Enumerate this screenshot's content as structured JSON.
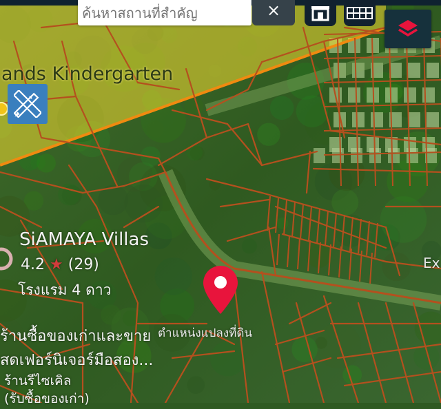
{
  "search": {
    "placeholder": "ค้นหาสถานที่สำคัญ",
    "clear_label": "×"
  },
  "icons": {
    "clear": "close-icon",
    "building": "building-icon",
    "grid": "grid-icon",
    "layers": "layers-icon",
    "measure": "ruler-pencil-icon",
    "pin": "map-pin-icon"
  },
  "colors": {
    "parcel_line": "#b4501e",
    "pin": "#e8143c",
    "zone_overlay": "#f5dc32",
    "tool_bg": "#11212f",
    "measure_bg": "#3a7fbe"
  },
  "map_labels": {
    "kindergarten": "ands Kindergarten",
    "hotel_name": "SiAMAYA Villas",
    "hotel_rating": "4.2",
    "hotel_reviews": "(29)",
    "hotel_category": "โรงแรม 4 ดาว",
    "shop_line1": "ร้านซื้อของเก่าและขาย",
    "shop_line2": "สดเฟอร์นิเจอร์มือสอง...",
    "shop_line3": "ร้านรีไซเคิล",
    "shop_line4": "(รับซื้อของเก่า)",
    "pin_caption": "ตำแหน่งแปลงที่ดิน",
    "edge_label": "Ex"
  }
}
